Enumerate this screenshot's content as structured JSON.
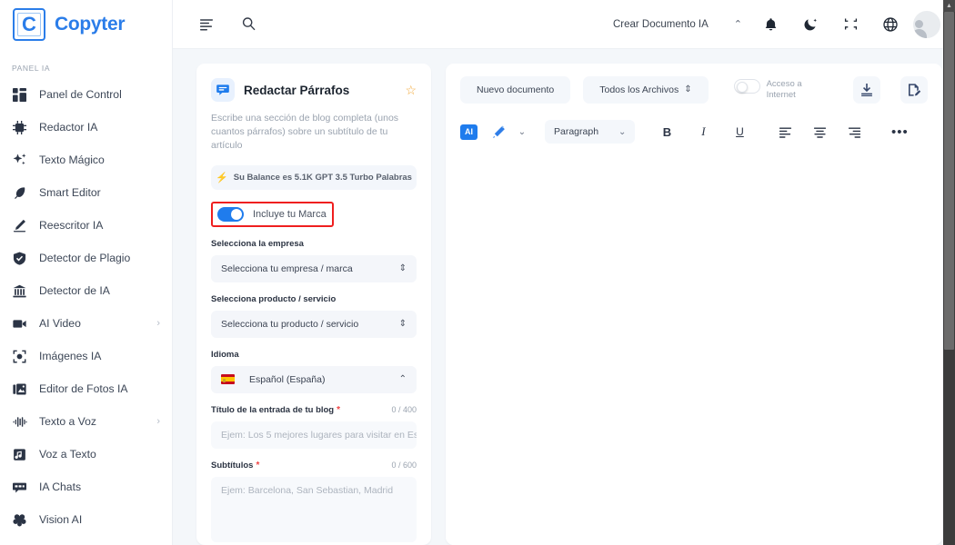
{
  "brand": {
    "mark": "C",
    "name": "Copyter"
  },
  "sidebar": {
    "section_label": "PANEL IA",
    "items": [
      {
        "label": "Panel de Control",
        "icon": "dashboard-icon",
        "chevron": ""
      },
      {
        "label": "Redactor IA",
        "icon": "ai-chip-icon",
        "chevron": ""
      },
      {
        "label": "Texto Mágico",
        "icon": "sparkles-icon",
        "chevron": ""
      },
      {
        "label": "Smart Editor",
        "icon": "feather-pen-icon",
        "chevron": ""
      },
      {
        "label": "Reescritor IA",
        "icon": "pencil-icon",
        "chevron": ""
      },
      {
        "label": "Detector de Plagio",
        "icon": "shield-check-icon",
        "chevron": ""
      },
      {
        "label": "Detector de IA",
        "icon": "bank-icon",
        "chevron": ""
      },
      {
        "label": "AI Video",
        "icon": "video-camera-icon",
        "chevron": "›"
      },
      {
        "label": "Imágenes IA",
        "icon": "image-frame-icon",
        "chevron": ""
      },
      {
        "label": "Editor de Fotos IA",
        "icon": "photo-editor-icon",
        "chevron": ""
      },
      {
        "label": "Texto a Voz",
        "icon": "waveform-icon",
        "chevron": "›"
      },
      {
        "label": "Voz a Texto",
        "icon": "music-note-icon",
        "chevron": ""
      },
      {
        "label": "IA Chats",
        "icon": "chat-bubble-icon",
        "chevron": ""
      },
      {
        "label": "Vision AI",
        "icon": "brain-icon",
        "chevron": ""
      }
    ]
  },
  "topbar": {
    "menu_icon": "align-left-icon",
    "search_icon": "search-icon",
    "create_doc_label": "Crear Documento IA",
    "caret": "⌃",
    "bell_icon": "bell-icon",
    "moon_icon": "moon-star-icon",
    "fullscreen_icon": "collapse-icon",
    "globe_icon": "globe-icon",
    "avatar": "user-avatar"
  },
  "form": {
    "icon": "speech-bubble-icon",
    "title": "Redactar Párrafos",
    "star": "☆",
    "description": "Escribe una sección de blog completa (unos cuantos párrafos) sobre un subtítulo de tu artículo",
    "balance_bolt": "⚡",
    "balance_text": "Su Balance es 5.1K GPT 3.5 Turbo Palabras",
    "brand_toggle": {
      "label": "Incluye tu Marca",
      "state": "on",
      "highlight_color": "#ef1f1f"
    },
    "company": {
      "label": "Selecciona la empresa",
      "value": "Selecciona tu empresa / marca",
      "indicator": "⇕"
    },
    "product": {
      "label": "Selecciona producto / servicio",
      "value": "Selecciona tu producto / servicio",
      "indicator": "⇕"
    },
    "language": {
      "label": "Idioma",
      "value": "Español (España)",
      "flag": "spain-flag",
      "indicator": "⌃"
    },
    "blog_title": {
      "label": "Título de la entrada de tu blog",
      "required": "*",
      "counter": "0 / 400",
      "placeholder": "Ejem: Los 5 mejores lugares para visitar en Es"
    },
    "subtitles": {
      "label": "Subtítulos",
      "required": "*",
      "counter": "0 / 600",
      "placeholder": "Ejem: Barcelona, San Sebastian, Madrid"
    }
  },
  "editor": {
    "new_document": "Nuevo documento",
    "all_files": "Todos los Archivos",
    "all_files_indicator": "⇕",
    "internet_access": "Acceso a Internet",
    "internet_state": "off",
    "download_icon": "download-icon",
    "export_icon": "export-doc-icon",
    "toolbar": {
      "ai_badge": "AI",
      "magic_icon": "magic-wand-icon",
      "magic_caret": "⌄",
      "block_format": "Paragraph",
      "block_caret": "⌄",
      "bold": "B",
      "italic": "I",
      "underline": "U",
      "align_left": "align-left-icon",
      "align_center": "align-center-icon",
      "align_right": "align-right-icon",
      "more": "•••"
    }
  },
  "colors": {
    "accent": "#2b7de9",
    "toggle_on": "#1f7ced",
    "highlight": "#ef1f1f",
    "page_bg": "#f4f7fa",
    "star": "#f2a93b"
  }
}
